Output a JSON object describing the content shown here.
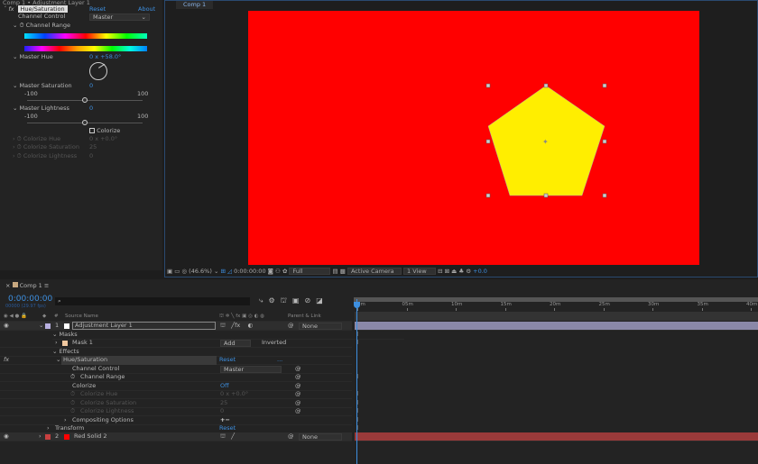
{
  "window": {
    "effect_panel_title": "Comp 1 • Adjustment Layer 1",
    "viewer_tab": "Comp 1"
  },
  "effect": {
    "name": "Hue/Saturation",
    "reset": "Reset",
    "about": "About",
    "channel_control_label": "Channel Control",
    "channel_control_value": "Master",
    "channel_range": "Channel Range",
    "master_hue_label": "Master Hue",
    "master_hue_value": "0 x +58.0°",
    "master_saturation_label": "Master Saturation",
    "master_saturation_value": "0",
    "sat_min": "-100",
    "sat_max": "100",
    "master_lightness_label": "Master Lightness",
    "master_lightness_value": "0",
    "light_min": "-100",
    "light_max": "100",
    "colorize_label": "Colorize",
    "colorize_checked": false,
    "colorize_hue_label": "Colorize Hue",
    "colorize_hue_value": "0 x +0.0°",
    "colorize_saturation_label": "Colorize Saturation",
    "colorize_saturation_value": "25",
    "colorize_lightness_label": "Colorize Lightness",
    "colorize_lightness_value": "0"
  },
  "viewer_toolbar": {
    "zoom": "(46.6%)",
    "timecode": "0:00:00:00",
    "resolution": "Full",
    "camera": "Active Camera",
    "views": "1 View",
    "exposure": "+0.0"
  },
  "colors": {
    "canvas": "#ff0000",
    "shape": "#ffee00",
    "accent": "#3d8fe0"
  },
  "timeline": {
    "tab": "Comp 1",
    "timecode": "0:00:00:00",
    "fps": "00000 (29.97 fps)",
    "search_placeholder": "",
    "col_source": "Source Name",
    "col_parent": "Parent & Link",
    "col_num": "#",
    "ruler": [
      "0m",
      "05m",
      "10m",
      "15m",
      "20m",
      "25m",
      "30m",
      "35m",
      "40m"
    ],
    "layers": [
      {
        "num": "1",
        "name": "Adjustment Layer 1",
        "parent": "None",
        "label_color": "#b8b0e0",
        "swatch": "#ffffff"
      },
      {
        "num": "2",
        "name": "Red Solid 2",
        "parent": "None",
        "label_color": "#c84040",
        "swatch": "#ff0000"
      }
    ],
    "masks": "Masks",
    "mask1": "Mask 1",
    "mask_mode": "Add",
    "inverted": "Inverted",
    "effects": "Effects",
    "effect_name": "Hue/Saturation",
    "reset": "Reset",
    "ellipsis": "...",
    "channel_control": "Channel Control",
    "channel_control_value": "Master",
    "channel_range": "Channel Range",
    "colorize": "Colorize",
    "colorize_value": "Off",
    "colorize_hue": "Colorize Hue",
    "colorize_hue_value": "0 x +0.0°",
    "colorize_saturation": "Colorize Saturation",
    "colorize_saturation_value": "25",
    "colorize_lightness": "Colorize Lightness",
    "colorize_lightness_value": "0",
    "compositing": "Compositing Options",
    "plus_minus": "+−",
    "transform": "Transform",
    "transform_reset": "Reset"
  }
}
